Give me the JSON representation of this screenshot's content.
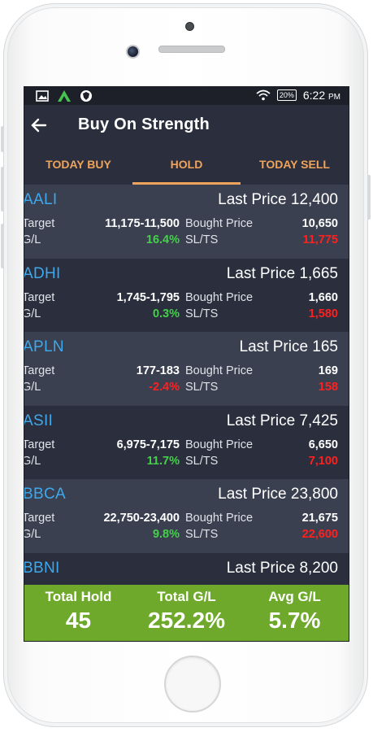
{
  "status_bar": {
    "battery": "20%",
    "time": "6:22",
    "ampm": "PM"
  },
  "header": {
    "title": "Buy On Strength"
  },
  "tabs": [
    {
      "label": "TODAY BUY",
      "active": false
    },
    {
      "label": "HOLD",
      "active": true
    },
    {
      "label": "TODAY SELL",
      "active": false
    }
  ],
  "labels": {
    "target": "Target",
    "gl": "G/L",
    "bought": "Bought Price",
    "slts": "SL/TS"
  },
  "stocks": [
    {
      "ticker": "AALI",
      "last": "Last Price 12,400",
      "target": "11,175-11,500",
      "gl": "16.4%",
      "gl_dir": "up",
      "bought": "10,650",
      "sl": "11,775"
    },
    {
      "ticker": "ADHI",
      "last": "Last Price 1,665",
      "target": "1,745-1,795",
      "gl": "0.3%",
      "gl_dir": "up",
      "bought": "1,660",
      "sl": "1,580"
    },
    {
      "ticker": "APLN",
      "last": "Last Price 165",
      "target": "177-183",
      "gl": "-2.4%",
      "gl_dir": "down",
      "bought": "169",
      "sl": "158"
    },
    {
      "ticker": "ASII",
      "last": "Last Price 7,425",
      "target": "6,975-7,175",
      "gl": "11.7%",
      "gl_dir": "up",
      "bought": "6,650",
      "sl": "7,100"
    },
    {
      "ticker": "BBCA",
      "last": "Last Price 23,800",
      "target": "22,750-23,400",
      "gl": "9.8%",
      "gl_dir": "up",
      "bought": "21,675",
      "sl": "22,600"
    },
    {
      "ticker": "BBNI",
      "last": "Last Price 8,200",
      "target": "",
      "gl": "",
      "gl_dir": "up",
      "bought": "",
      "sl": ""
    }
  ],
  "footer": {
    "total_hold_label": "Total Hold",
    "total_hold": "45",
    "total_gl_label": "Total G/L",
    "total_gl": "252.2%",
    "avg_gl_label": "Avg G/L",
    "avg_gl": "5.7%"
  },
  "colors": {
    "accent": "#f0a35a",
    "ticker": "#3ea8ec",
    "gain": "#44d04a",
    "loss": "#ff2020",
    "footer_bg": "#6fa92c"
  },
  "icons": [
    "image-icon",
    "app-logo-icon",
    "shield-icon",
    "wifi-icon",
    "battery-icon",
    "back-arrow-icon"
  ]
}
